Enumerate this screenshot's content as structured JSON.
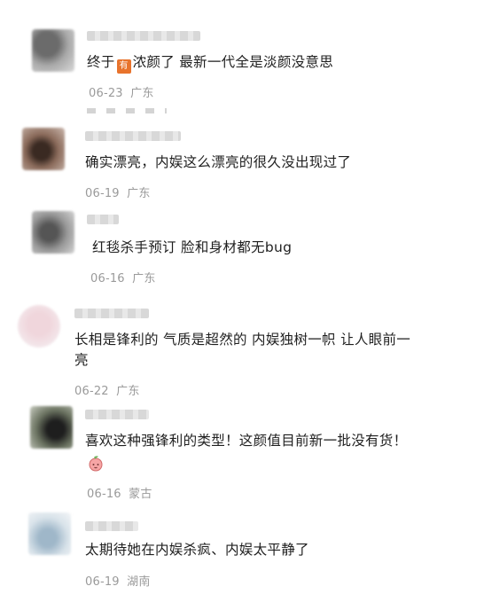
{
  "comments": [
    {
      "text_before": "终于",
      "badge": "有",
      "text_after": "浓颜了 最新一代全是淡颜没意思",
      "date": "06-23",
      "location": "广东"
    },
    {
      "text": "确实漂亮，内娱这么漂亮的很久没出现过了",
      "date": "06-19",
      "location": "广东"
    },
    {
      "text": "红毯杀手预订 脸和身材都无bug",
      "date": "06-16",
      "location": "广东"
    },
    {
      "text_line1": "长相是锋利的 气质是超然的 内娱独树一帜 让人眼前一",
      "text_line2": "亮",
      "date": "06-22",
      "location": "广东"
    },
    {
      "text": "喜欢这种强锋利的类型！这颜值目前新一批没有货！",
      "emoji": "peach-emoji",
      "date": "06-16",
      "location": "蒙古"
    },
    {
      "text": "太期待她在内娱杀疯、内娱太平静了",
      "date": "06-19",
      "location": "湖南"
    }
  ],
  "colors": {
    "text": "#1f1f1f",
    "meta": "#9a9a9a",
    "badge": "#e8732c"
  }
}
